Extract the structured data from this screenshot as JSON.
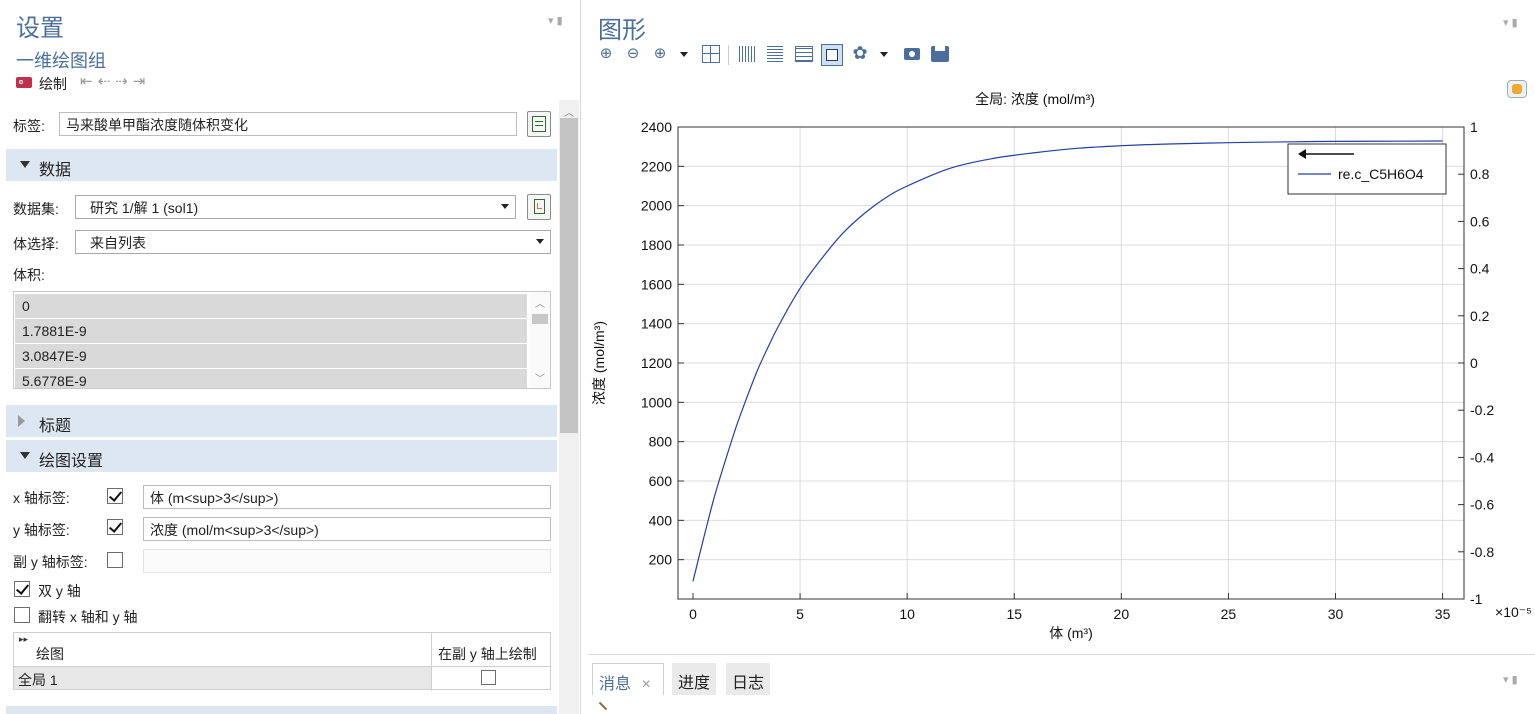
{
  "settings": {
    "title": "设置",
    "subtitle": "一维绘图组",
    "plot_button": "绘制",
    "label_caption": "标签:",
    "label_value": "马来酸单甲酯浓度随体积变化",
    "section_data": "数据",
    "dataset_caption": "数据集:",
    "dataset_value": "研究 1/解 1 (sol1)",
    "volume_select_caption": "体选择:",
    "volume_select_value": "来自列表",
    "volume_caption": "体积:",
    "volume_list": [
      "0",
      "1.7881E-9",
      "3.0847E-9",
      "5.6778E-9"
    ],
    "section_title": "标题",
    "section_plot_settings": "绘图设置",
    "x_axis_label_caption": "x 轴标签:",
    "x_axis_label_checked": true,
    "x_axis_label_value": "体 (m<sup>3</sup>)",
    "y_axis_label_caption": "y 轴标签:",
    "y_axis_label_checked": true,
    "y_axis_label_value": "浓度 (mol/m<sup>3</sup>)",
    "sec_y_axis_label_caption": "副 y 轴标签:",
    "sec_y_axis_label_checked": false,
    "sec_y_axis_label_value": "",
    "dual_y_caption": "双 y 轴",
    "dual_y_checked": true,
    "flip_caption": "翻转 x 轴和 y 轴",
    "flip_checked": false,
    "table_col_plot": "绘图",
    "table_col_secondary": "在副 y 轴上绘制",
    "table_row_name": "全局 1",
    "table_row_secondary_checked": false
  },
  "graphics": {
    "title": "图形"
  },
  "bottom_tabs": [
    "消息",
    "进度",
    "日志"
  ],
  "colors": {
    "accent": "#4a6f9c",
    "section": "#dde7f2",
    "series": "#1f3fae"
  },
  "chart_data": {
    "type": "line",
    "title": "全局: 浓度 (mol/m³)",
    "xlabel": "体 (m³)",
    "ylabel": "浓度 (mol/m³)",
    "x_scale_note": "×10⁻⁵",
    "xlim": [
      -0.7,
      36.0
    ],
    "ylim": [
      0,
      2400
    ],
    "y2lim": [
      -1,
      1
    ],
    "x_ticks": [
      "0",
      "5",
      "10",
      "15",
      "20",
      "25",
      "30",
      "35"
    ],
    "y_ticks": [
      "200",
      "400",
      "600",
      "800",
      "1000",
      "1200",
      "1400",
      "1600",
      "1800",
      "2000",
      "2200",
      "2400"
    ],
    "y2_ticks": [
      "-1",
      "-0.8",
      "-0.6",
      "-0.4",
      "-0.2",
      "0",
      "0.2",
      "0.4",
      "0.6",
      "0.8",
      "1"
    ],
    "grid": true,
    "legend_position": "top-right",
    "series": [
      {
        "name": "re.c_C5H6O4",
        "color": "#1f3fae",
        "x": [
          0,
          0.5,
          1,
          1.5,
          2,
          2.5,
          3,
          3.5,
          4,
          5,
          6,
          7,
          8,
          9,
          10,
          12,
          14,
          16,
          18,
          20,
          22,
          25,
          28,
          30,
          33,
          35
        ],
        "y": [
          90,
          310,
          520,
          700,
          870,
          1020,
          1160,
          1280,
          1390,
          1580,
          1730,
          1860,
          1960,
          2040,
          2100,
          2190,
          2240,
          2270,
          2292,
          2305,
          2313,
          2320,
          2325,
          2327,
          2328,
          2329
        ]
      }
    ]
  }
}
